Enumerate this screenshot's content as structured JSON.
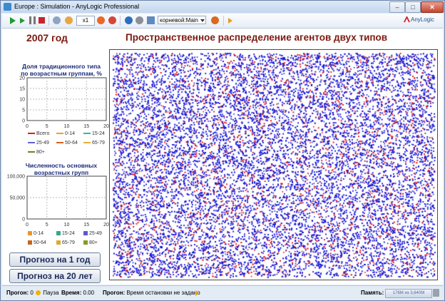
{
  "window": {
    "title": "Europe : Simulation - AnyLogic Professional",
    "minimize_glyph": "–",
    "maximize_glyph": "□",
    "close_glyph": "✕"
  },
  "toolbar": {
    "speed_label": "x1",
    "root_select": "корневой:Main",
    "brand": "AnyLogic",
    "icons": [
      "run-icon",
      "run-dropdown-icon",
      "step-icon",
      "pause-icon",
      "stop-icon",
      "agents-icon",
      "clock-icon",
      "speed-box",
      "slow-down-icon",
      "speed-up-icon",
      "navigate-icon",
      "camera-icon",
      "root-icon",
      "go-to-root-icon",
      "reload-icon"
    ]
  },
  "header": {
    "year": "2007",
    "year_suffix": "год",
    "title": "Пространственное распределение агентов двух типов"
  },
  "chart1": {
    "title_line1": "Доля традиционного типа",
    "title_line2": "по возрастным группам, %",
    "chart_data": {
      "type": "line",
      "title": "Доля традиционного типа по возрастным группам, %",
      "xlim": [
        0,
        20
      ],
      "ylim": [
        0,
        20
      ],
      "x_ticks": [
        "0",
        "5",
        "10",
        "15",
        "20"
      ],
      "y_ticks": [
        "0",
        "5",
        "10",
        "15",
        "20"
      ],
      "grid": true,
      "legend_placement": "bottom",
      "series": [
        {
          "name": "Всего",
          "color": "#d42020",
          "values": []
        },
        {
          "name": "0-14",
          "color": "#e8a030",
          "values": []
        },
        {
          "name": "15-24",
          "color": "#40b0a0",
          "values": []
        },
        {
          "name": "25-49",
          "color": "#6060d0",
          "values": []
        },
        {
          "name": "50-64",
          "color": "#d06020",
          "values": []
        },
        {
          "name": "65-79",
          "color": "#e0b030",
          "values": []
        },
        {
          "name": "80+",
          "color": "#708020",
          "values": []
        }
      ]
    }
  },
  "chart2": {
    "title_line1": "Численность основных",
    "title_line2": "возрастных групп",
    "chart_data": {
      "type": "bar",
      "title": "Численность основных возрастных групп",
      "xlim": [
        0,
        20
      ],
      "ylim": [
        0,
        100000
      ],
      "x_ticks": [
        "0",
        "5",
        "10",
        "15",
        "20"
      ],
      "y_ticks": [
        "0",
        "50,000",
        "100,000"
      ],
      "grid": true,
      "legend_placement": "bottom",
      "series": [
        {
          "name": "0-14",
          "color": "#e8962a",
          "values": []
        },
        {
          "name": "15-24",
          "color": "#3aa58f",
          "values": []
        },
        {
          "name": "25-49",
          "color": "#5a5ad0",
          "values": []
        },
        {
          "name": "50-64",
          "color": "#c8661e",
          "values": []
        },
        {
          "name": "65-79",
          "color": "#e0a830",
          "values": []
        },
        {
          "name": "80+",
          "color": "#8a9a20",
          "values": []
        }
      ]
    }
  },
  "buttons": {
    "forecast_1": "Прогноз на 1 год",
    "forecast_20": "Прогноз на 20 лет"
  },
  "field": {
    "colors": {
      "type_a": "#1515d8",
      "type_b": "#d81818",
      "background": "#ffffff"
    }
  },
  "status": {
    "progress_label": "Прогон:",
    "progress_value": "0",
    "state": "Пауза",
    "time_label": "Время:",
    "time_value": "0.00",
    "stop_label": "Прогон:",
    "stop_value": "Время остановки не задано",
    "memory_label": "Память:",
    "memory_value": "176M из 3,640M"
  },
  "colors": {
    "heading": "#7b1a10",
    "chart_title": "#1a2a7a",
    "window_frame": "#6b84a6"
  }
}
